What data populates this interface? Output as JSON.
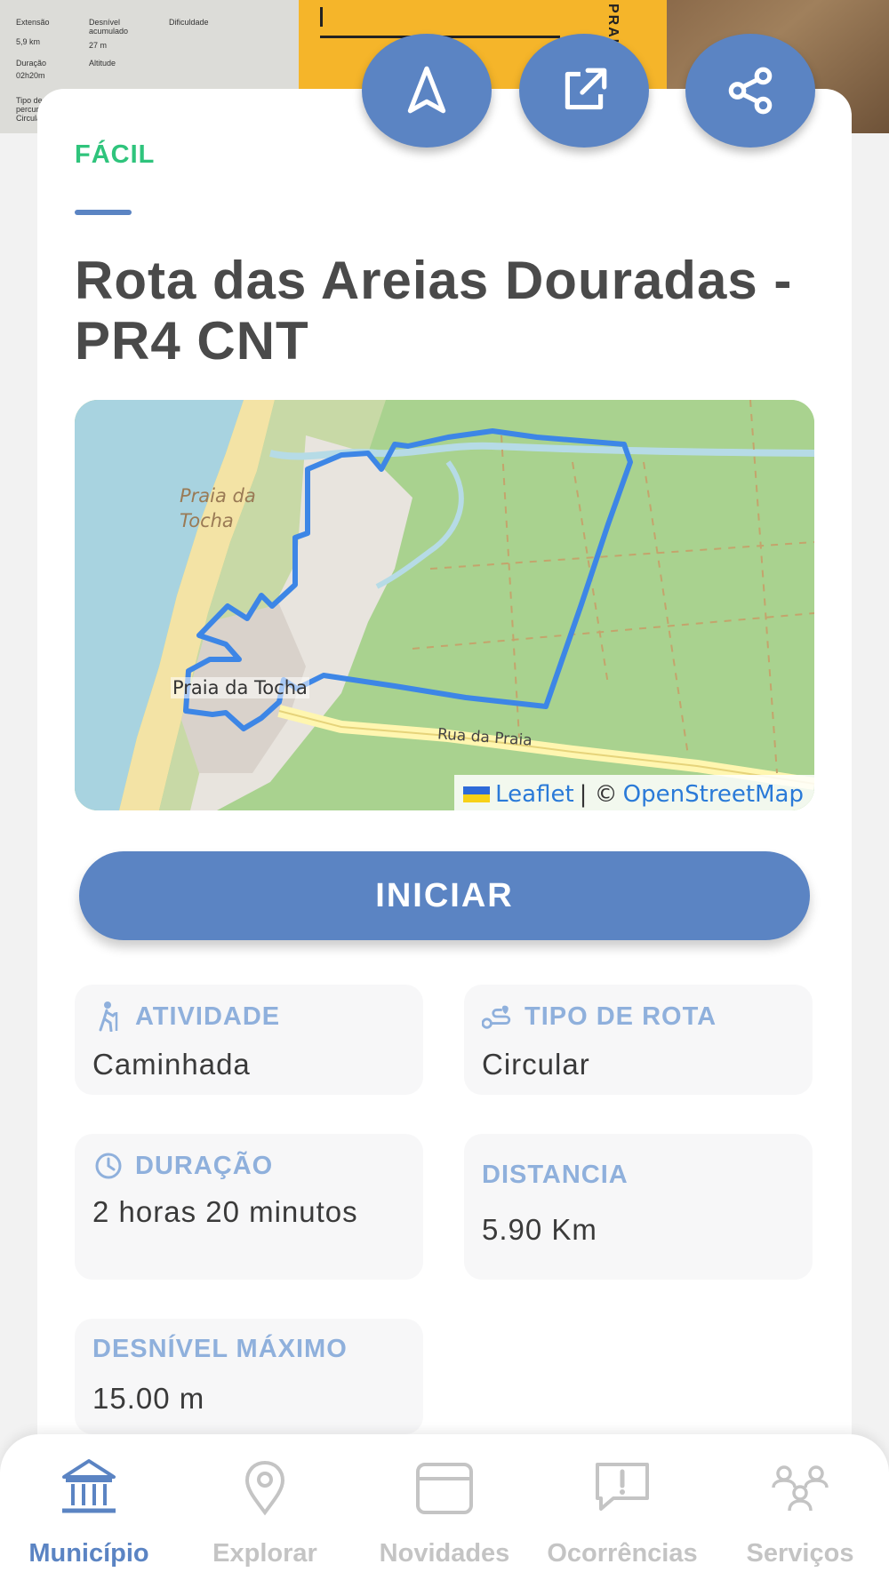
{
  "hero": {
    "board_cells": [
      "Extensão",
      "Desnível acumulado",
      "Dificuldade",
      "5,9 km",
      "27 m",
      "Duração",
      "Altitude",
      "02h20m",
      "Tipo de percurso",
      "Circular"
    ],
    "sign_vertical": "PRAIA DA",
    "colors": {
      "sign": "#f5b52a",
      "board": "#dcdcd8"
    }
  },
  "actions": {
    "navigate_icon": "navigation-arrow-icon",
    "open_external_icon": "open-external-icon",
    "share_icon": "share-icon"
  },
  "route": {
    "difficulty": "FÁCIL",
    "title": "Rota das Areias Douradas - PR4 CNT"
  },
  "map": {
    "labels": {
      "beach_italic_1": "Praia da",
      "beach_italic_2": "Tocha",
      "town": "Praia da Tocha",
      "street": "Rua da Praia"
    },
    "attribution": {
      "leaflet": "Leaflet",
      "separator": "| ©",
      "osm": "OpenStreetMap"
    },
    "colors": {
      "route": "#3d86e6",
      "land": "#a9d28f",
      "sea": "#a8d3e0",
      "sand": "#f3e3a5"
    }
  },
  "start_button": {
    "label": "INICIAR"
  },
  "info": {
    "atividade": {
      "label": "ATIVIDADE",
      "value": "Caminhada",
      "icon": "hiking-icon"
    },
    "tipo_rota": {
      "label": "TIPO DE ROTA",
      "value": "Circular",
      "icon": "route-type-icon"
    },
    "duracao": {
      "label": "DURAÇÃO",
      "value": "2 horas 20 minutos",
      "icon": "clock-icon"
    },
    "distancia": {
      "label": "DISTANCIA",
      "value": "5.90 Km"
    },
    "desnivel": {
      "label": "DESNÍVEL MÁXIMO",
      "value": "15.00 m"
    }
  },
  "nav": {
    "items": [
      {
        "label": "Município",
        "icon": "town-hall-icon",
        "active": true
      },
      {
        "label": "Explorar",
        "icon": "map-pin-icon",
        "active": false
      },
      {
        "label": "Novidades",
        "icon": "card-icon",
        "active": false
      },
      {
        "label": "Ocorrências",
        "icon": "alert-message-icon",
        "active": false
      },
      {
        "label": "Serviços",
        "icon": "people-icon",
        "active": false
      }
    ]
  },
  "theme": {
    "accent": "#5b84c3",
    "easy": "#2fc47c",
    "tile_label": "#8fb0dc"
  }
}
